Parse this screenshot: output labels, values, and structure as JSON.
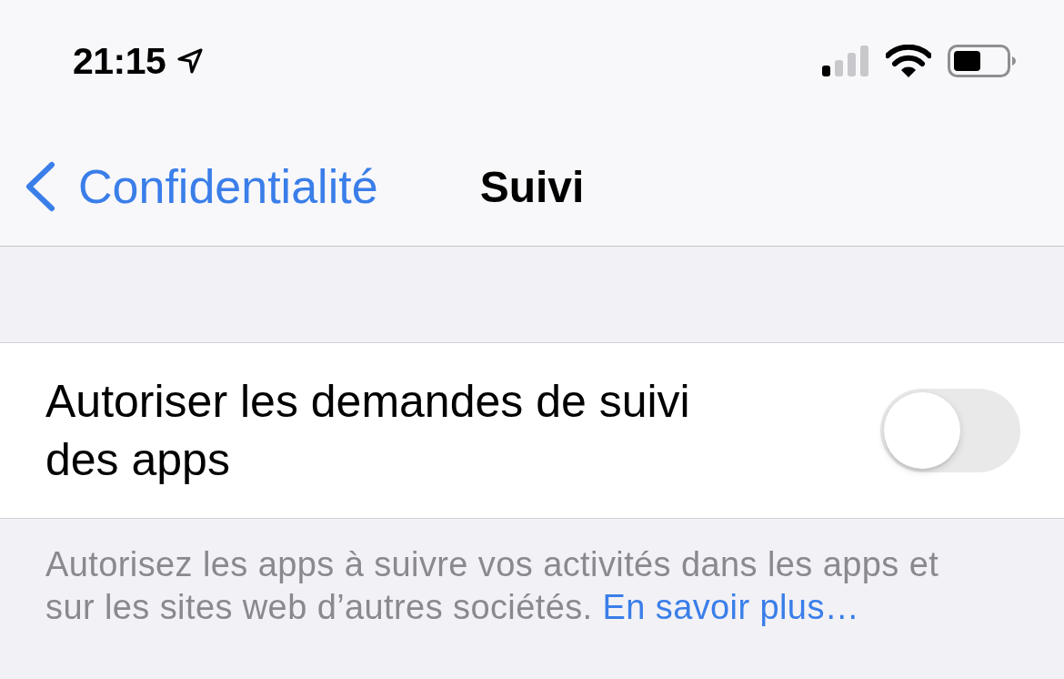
{
  "status_bar": {
    "time": "21:15"
  },
  "nav_bar": {
    "back_label": "Confidentialité",
    "title": "Suivi"
  },
  "settings": [
    {
      "kind": "toggle",
      "label": "Autoriser les demandes de suivi des apps",
      "on": false
    }
  ],
  "footer": {
    "text": "Autorisez les apps à suivre vos activités dans les apps et sur les sites web d’autres sociétés.",
    "link": "En savoir plus…"
  }
}
